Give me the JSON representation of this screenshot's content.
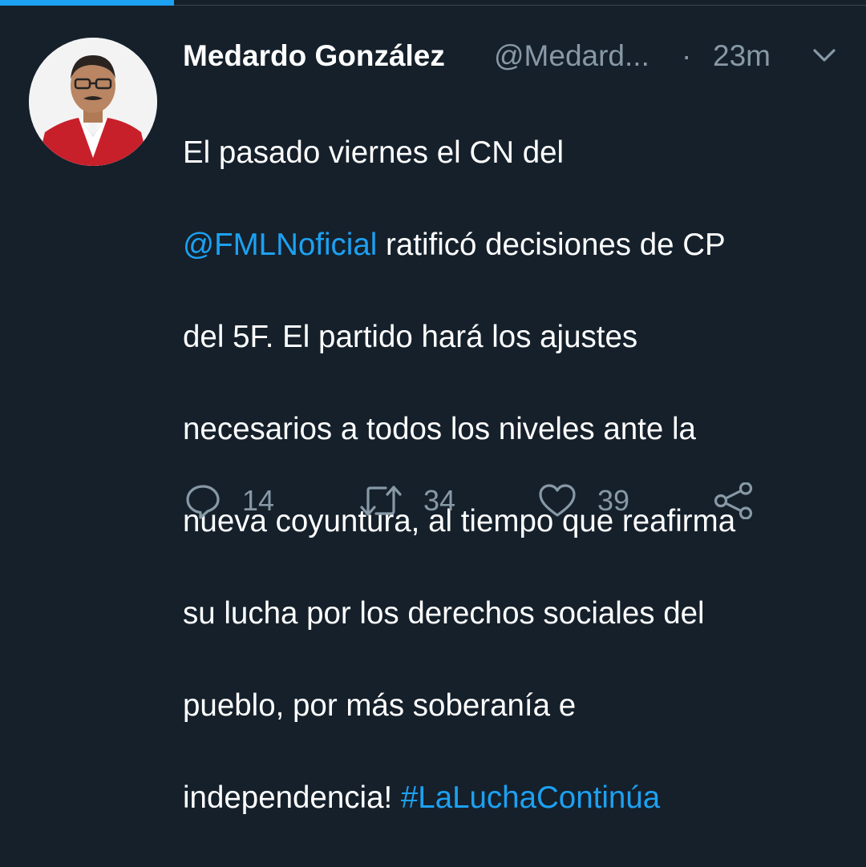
{
  "colors": {
    "background": "#15202b",
    "text": "#ffffff",
    "muted": "#8899a6",
    "link": "#1da1f2"
  },
  "tweet": {
    "display_name": "Medardo González",
    "handle": "@Medard...",
    "separator": "·",
    "time": "23m",
    "body": {
      "line1": "El pasado viernes el CN del",
      "mention": "@FMLNoficial",
      "line2_rest": " ratificó decisiones de CP",
      "line3": "del 5F. El partido hará los ajustes",
      "line4": "necesarios a todos los niveles ante la",
      "line5": "nueva coyuntura, al tiempo que reafirma",
      "line6": "su lucha por los derechos sociales del",
      "line7": "pueblo, por más soberanía e",
      "line8": "independencia! ",
      "hashtag": "#LaLuchaContinúa"
    },
    "actions": {
      "reply_count": "14",
      "retweet_count": "34",
      "like_count": "39"
    },
    "icons": {
      "avatar": "avatar-photo",
      "caret": "chevron-down-icon",
      "reply": "reply-icon",
      "retweet": "retweet-icon",
      "like": "heart-icon",
      "share": "share-icon"
    }
  }
}
